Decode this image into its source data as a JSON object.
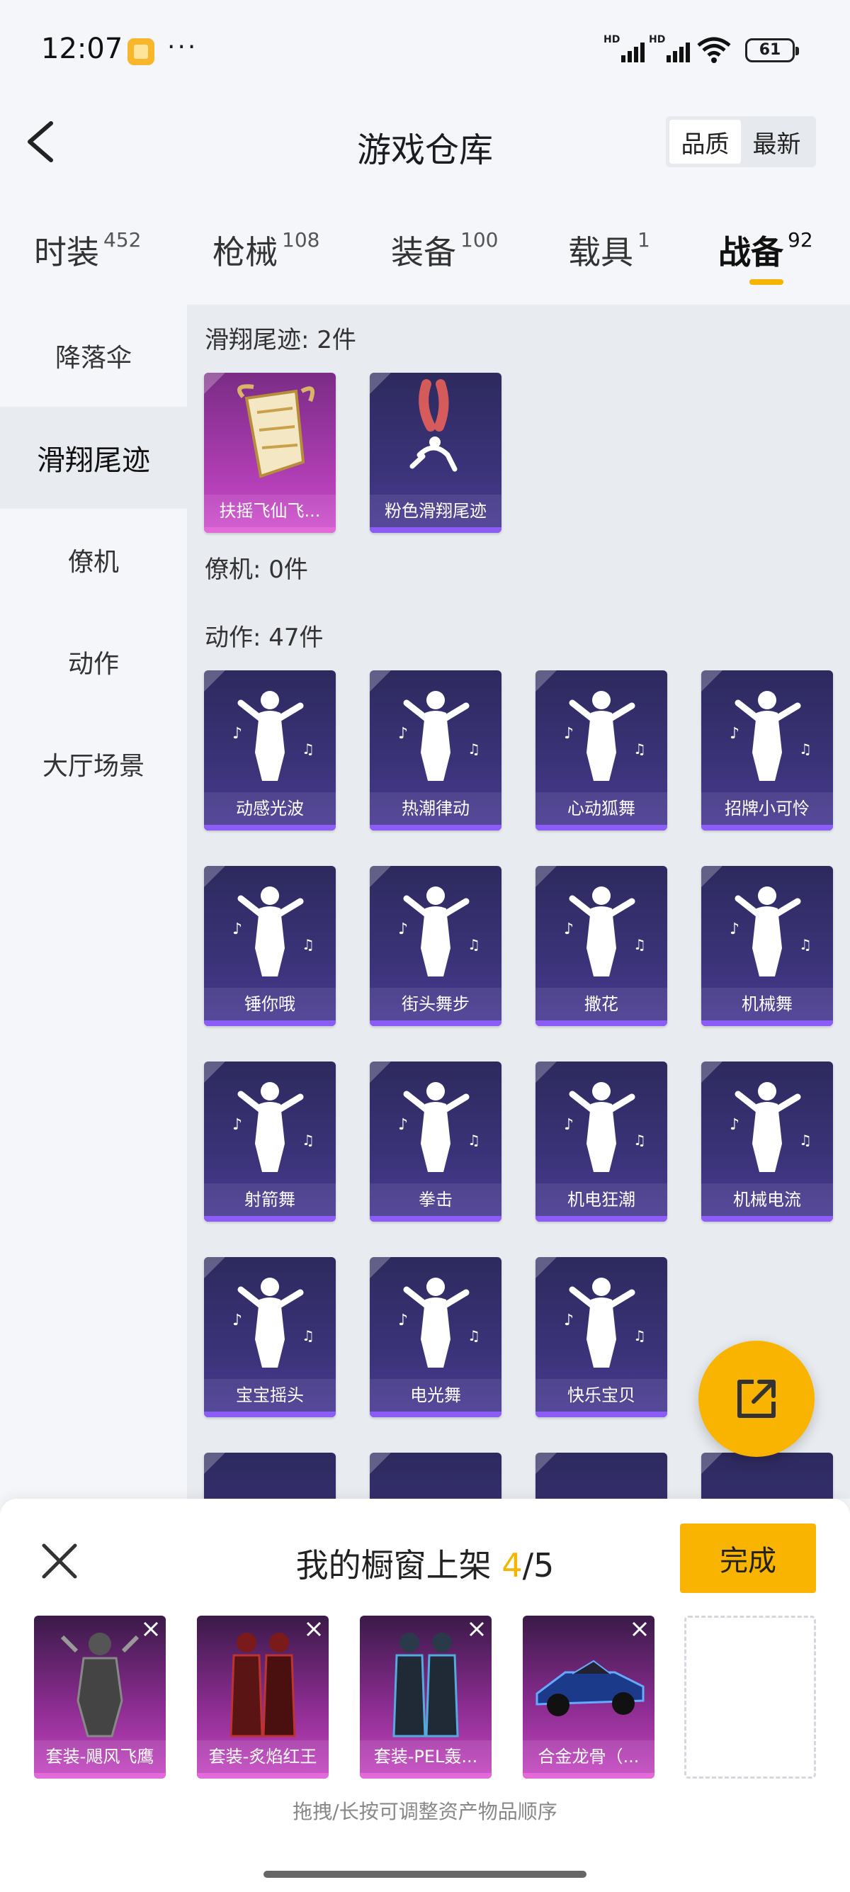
{
  "status_bar": {
    "time": "12:07",
    "more": "···",
    "net1": "HD",
    "net2": "HD",
    "battery": "61"
  },
  "header": {
    "title": "游戏仓库",
    "sort_options": [
      "品质",
      "最新"
    ]
  },
  "tabs": [
    {
      "label": "时装",
      "count": "452"
    },
    {
      "label": "枪械",
      "count": "108"
    },
    {
      "label": "装备",
      "count": "100"
    },
    {
      "label": "载具",
      "count": "1"
    },
    {
      "label": "战备",
      "count": "92"
    }
  ],
  "sidebar": [
    "降落伞",
    "滑翔尾迹",
    "僚机",
    "动作",
    "大厅场景"
  ],
  "sections": {
    "trail": {
      "title": "滑翔尾迹: 2件",
      "items": [
        "扶摇飞仙飞...",
        "粉色滑翔尾迹"
      ]
    },
    "wingman": {
      "title": "僚机: 0件"
    },
    "emote": {
      "title": "动作: 47件",
      "items": [
        "动感光波",
        "热潮律动",
        "心动狐舞",
        "招牌小可怜",
        "锤你哦",
        "街头舞步",
        "撒花",
        "机械舞",
        "射箭舞",
        "拳击",
        "机电狂潮",
        "机械电流",
        "宝宝摇头",
        "电光舞",
        "快乐宝贝"
      ]
    }
  },
  "sheet": {
    "title_prefix": "我的橱窗上架 ",
    "count": "4",
    "total": "/5",
    "done": "完成",
    "items": [
      "套装-飓风飞鹰",
      "套装-炙焰红王",
      "套装-PEL轰...",
      "合金龙骨（..."
    ],
    "hint": "拖拽/长按可调整资产物品顺序"
  },
  "icons": {
    "back": "back-arrow-icon",
    "fab": "share-export-icon",
    "close": "close-icon"
  },
  "colors": {
    "accent": "#f8b400",
    "card_purple": "#3b3379",
    "card_pink": "#b43fb7"
  }
}
